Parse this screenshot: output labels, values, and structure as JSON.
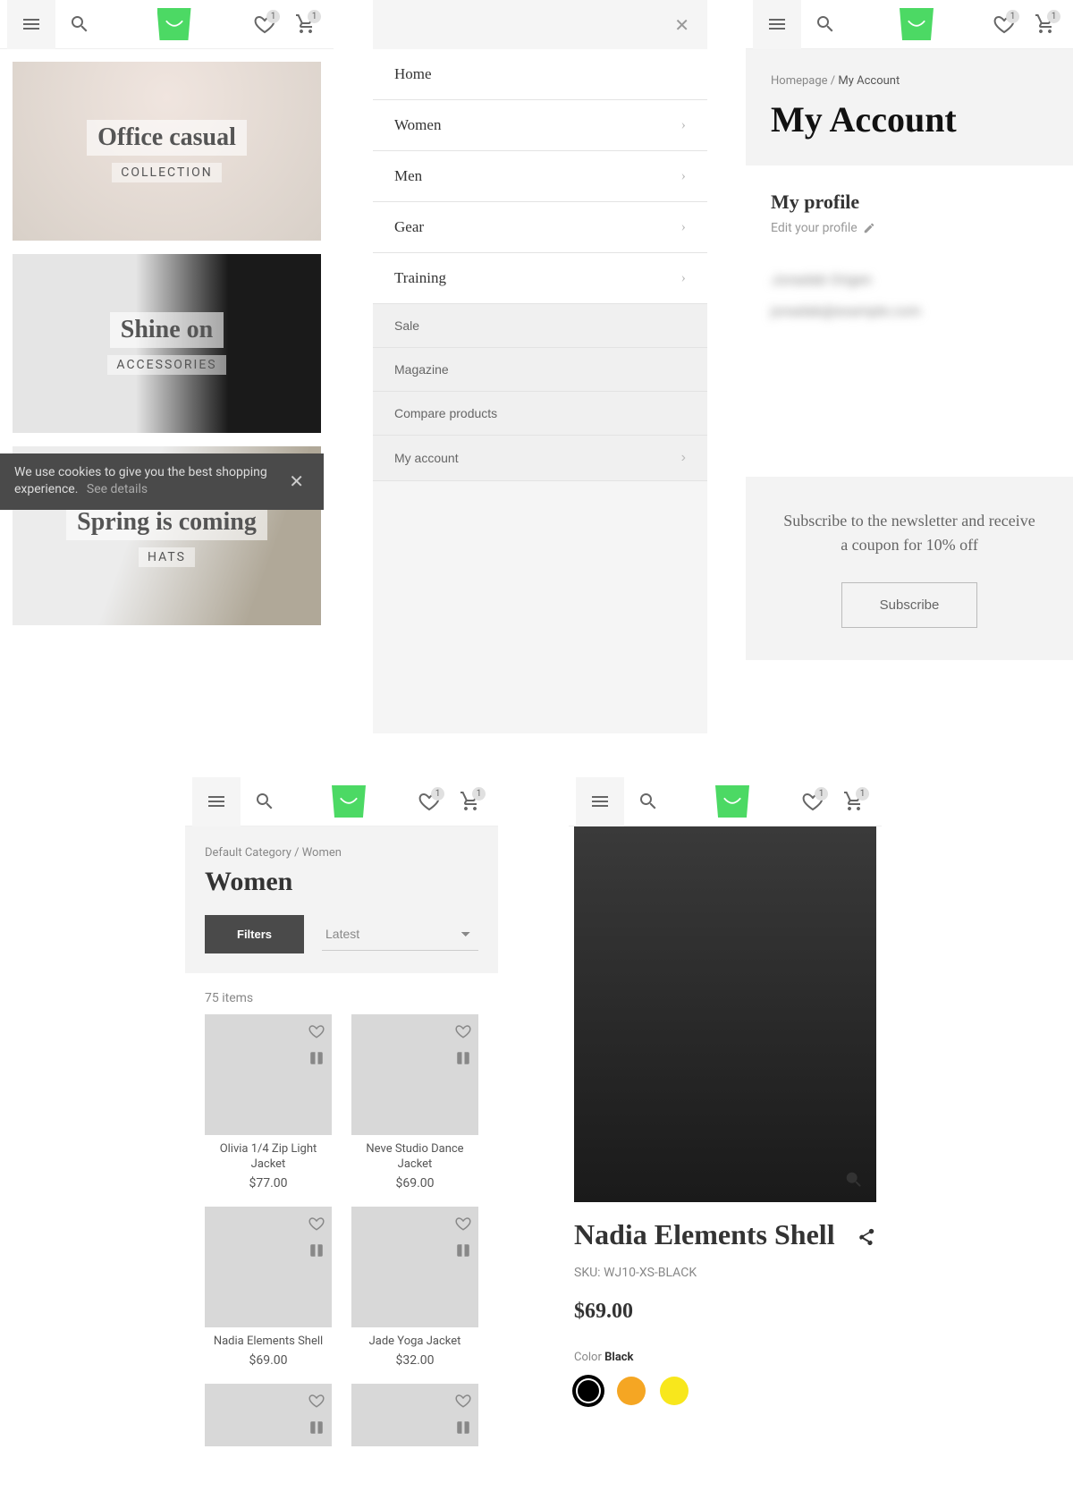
{
  "header": {
    "wishlist_badge": "1",
    "cart_badge": "1"
  },
  "screen1": {
    "collections": [
      {
        "title": "Office casual",
        "sub": "COLLECTION"
      },
      {
        "title": "Shine on",
        "sub": "ACCESSORIES"
      },
      {
        "title": "Spring is coming",
        "sub": "HATS"
      }
    ],
    "cookie_text": "We use cookies to give you the best shopping experience.",
    "cookie_details": "See details"
  },
  "screen2": {
    "primary": [
      {
        "label": "Home",
        "arrow": false
      },
      {
        "label": "Women",
        "arrow": true
      },
      {
        "label": "Men",
        "arrow": true
      },
      {
        "label": "Gear",
        "arrow": true
      },
      {
        "label": "Training",
        "arrow": true
      }
    ],
    "secondary": [
      {
        "label": "Sale",
        "arrow": false
      },
      {
        "label": "Magazine",
        "arrow": false
      },
      {
        "label": "Compare products",
        "arrow": false
      },
      {
        "label": "My account",
        "arrow": true
      }
    ]
  },
  "screen3": {
    "bc_home": "Homepage",
    "bc_current": "My Account",
    "title": "My Account",
    "profile_h": "My profile",
    "profile_edit": "Edit your profile",
    "blur_name": "Jonadab Origen",
    "blur_email": "jonadab@example.com",
    "news_text": "Subscribe to the newsletter and receive a coupon for 10% off",
    "news_btn": "Subscribe"
  },
  "screen4": {
    "bc": "Default Category / Women",
    "title": "Women",
    "filters_btn": "Filters",
    "sort_label": "Latest",
    "count": "75 items",
    "products": [
      {
        "name": "Olivia 1/4 Zip Light Jacket",
        "price": "$77.00",
        "cls": "ph-blue1"
      },
      {
        "name": "Neve Studio Dance Jacket",
        "price": "$69.00",
        "cls": "ph-blue2"
      },
      {
        "name": "Nadia Elements Shell",
        "price": "$69.00",
        "cls": "ph-lime"
      },
      {
        "name": "Jade Yoga Jacket",
        "price": "$32.00",
        "cls": "ph-mint"
      },
      {
        "name": "",
        "price": "",
        "cls": "ph-grey"
      },
      {
        "name": "",
        "price": "",
        "cls": "ph-purple"
      }
    ]
  },
  "screen5": {
    "title": "Nadia Elements Shell",
    "sku_label": "SKU:",
    "sku": "WJ10-XS-BLACK",
    "price": "$69.00",
    "color_label": "Color",
    "color_value": "Black",
    "swatches": [
      {
        "color": "#000000",
        "selected": true
      },
      {
        "color": "#f5a623",
        "selected": false
      },
      {
        "color": "#f8e71c",
        "selected": false
      }
    ]
  }
}
